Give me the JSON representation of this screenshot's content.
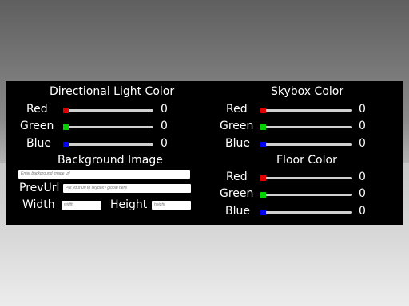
{
  "directional": {
    "title": "Directional Light Color",
    "red": {
      "label": "Red",
      "value": "0",
      "color": "#e00000"
    },
    "green": {
      "label": "Green",
      "value": "0",
      "color": "#00d000"
    },
    "blue": {
      "label": "Blue",
      "value": "0",
      "color": "#0000f0"
    }
  },
  "skybox": {
    "title": "Skybox Color",
    "red": {
      "label": "Red",
      "value": "0",
      "color": "#e00000"
    },
    "green": {
      "label": "Green",
      "value": "0",
      "color": "#00d000"
    },
    "blue": {
      "label": "Blue",
      "value": "0",
      "color": "#0000f0"
    }
  },
  "floor": {
    "title": "Floor Color",
    "red": {
      "label": "Red",
      "value": "0",
      "color": "#e00000"
    },
    "green": {
      "label": "Green",
      "value": "0",
      "color": "#00d000"
    },
    "blue": {
      "label": "Blue",
      "value": "0",
      "color": "#0000f0"
    }
  },
  "background": {
    "title": "Background Image",
    "url_placeholder": "Enter background image url",
    "prev_label": "PrevUrl",
    "prev_placeholder": "Put your url to skybox / global here",
    "width_label": "Width",
    "width_placeholder": "width",
    "height_label": "Height",
    "height_placeholder": "height"
  }
}
